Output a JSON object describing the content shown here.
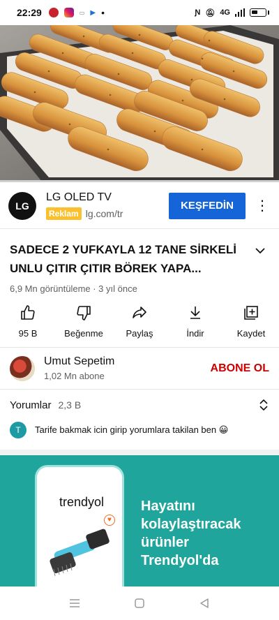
{
  "status_bar": {
    "time": "22:29",
    "network_label": "4G"
  },
  "video": {
    "progress_fraction": 0.0
  },
  "ad": {
    "logo_text": "LG",
    "advertiser": "LG OLED TV",
    "badge": "Reklam",
    "domain": "lg.com/tr",
    "cta": "KEŞFEDİN"
  },
  "video_info": {
    "title": "SADECE 2 YUFKAYLA 12 TANE SİRKELİ UNLU ÇITIR ÇITIR BÖREK YAPA...",
    "meta": "6,9 Mn görüntüleme · 3 yıl önce"
  },
  "actions": [
    {
      "label": "95 B",
      "icon": "thumbs-up-icon"
    },
    {
      "label": "Beğenme",
      "icon": "thumbs-down-icon"
    },
    {
      "label": "Paylaş",
      "icon": "share-icon"
    },
    {
      "label": "İndir",
      "icon": "download-icon"
    },
    {
      "label": "Kaydet",
      "icon": "add-to-playlist-icon"
    }
  ],
  "channel": {
    "name": "Umut Sepetim",
    "subscribers": "1,02 Mn abone",
    "subscribe_label": "ABONE OL"
  },
  "comments": {
    "label": "Yorumlar",
    "count": "2,3 B",
    "top_comment": {
      "avatar_letter": "T",
      "text": "Tarife bakmak icin girip yorumlara takilan ben 😀"
    }
  },
  "promo": {
    "brand": "trendyol",
    "headline_lines": [
      "Hayatını",
      "kolaylaştıracak",
      "ürünler",
      "Trendyol'da"
    ]
  },
  "colors": {
    "cta_blue": "#1565d8",
    "subscribe_red": "#cc0000",
    "ad_badge_yellow": "#fbc02d",
    "promo_teal": "#1fa59b"
  }
}
